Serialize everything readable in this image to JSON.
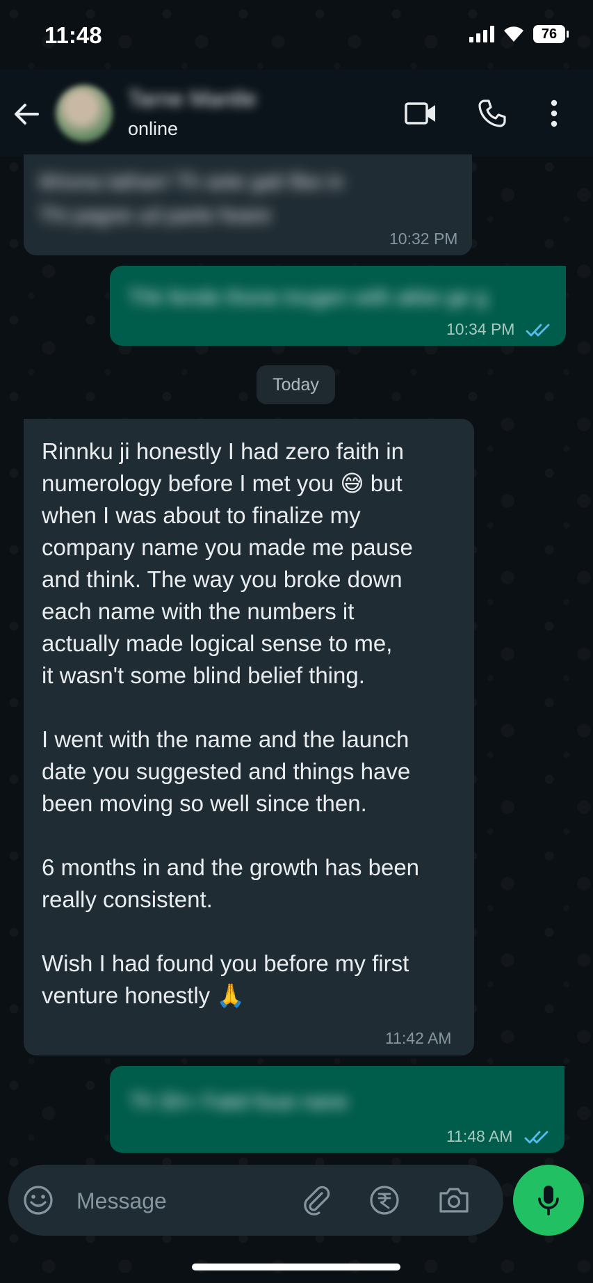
{
  "status_bar": {
    "time": "11:48",
    "battery": "76"
  },
  "header": {
    "contact_name": "Tarne Mantle",
    "status": "online"
  },
  "messages": [
    {
      "direction": "in",
      "text": "Ikhona lathan! Th sete gali fike in\nThi pagne ud parte fware",
      "time": "10:32 PM",
      "blurred": true
    },
    {
      "direction": "out",
      "text": "Thk fende thone tnugen with akke ge g",
      "time": "10:34 PM",
      "read": true,
      "blurred": true
    },
    {
      "direction": "in",
      "text": "Rinnku ji honestly I had zero faith in\nnumerology before I met you 😅 but\nwhen I was about to finalize my\ncompany name you made me pause\nand think. The way you broke down\neach name with the numbers it\nactually made logical sense to me,\nit wasn't some blind belief thing.\n\nI went with the name and the launch\ndate you suggested and things have\nbeen moving so well since then.\n\n6 months in and the growth has been\nreally consistent.\n\nWish I had found you before my first\nventure honestly 🙏",
      "time": "11:42 AM"
    },
    {
      "direction": "out",
      "text": "Th Sh+ Fatel foue nane",
      "time": "11:48 AM",
      "read": true,
      "blurred": true
    }
  ],
  "date_divider": "Today",
  "composer": {
    "placeholder": "Message"
  },
  "colors": {
    "incoming_bubble": "#202c33",
    "outgoing_bubble": "#005c4b",
    "mic_button": "#21c063",
    "read_ticks": "#53bdeb"
  },
  "icons": [
    "back-arrow-icon",
    "video-call-icon",
    "phone-icon",
    "more-vert-icon",
    "emoji-icon",
    "attach-icon",
    "rupee-payment-icon",
    "camera-icon",
    "mic-icon"
  ]
}
